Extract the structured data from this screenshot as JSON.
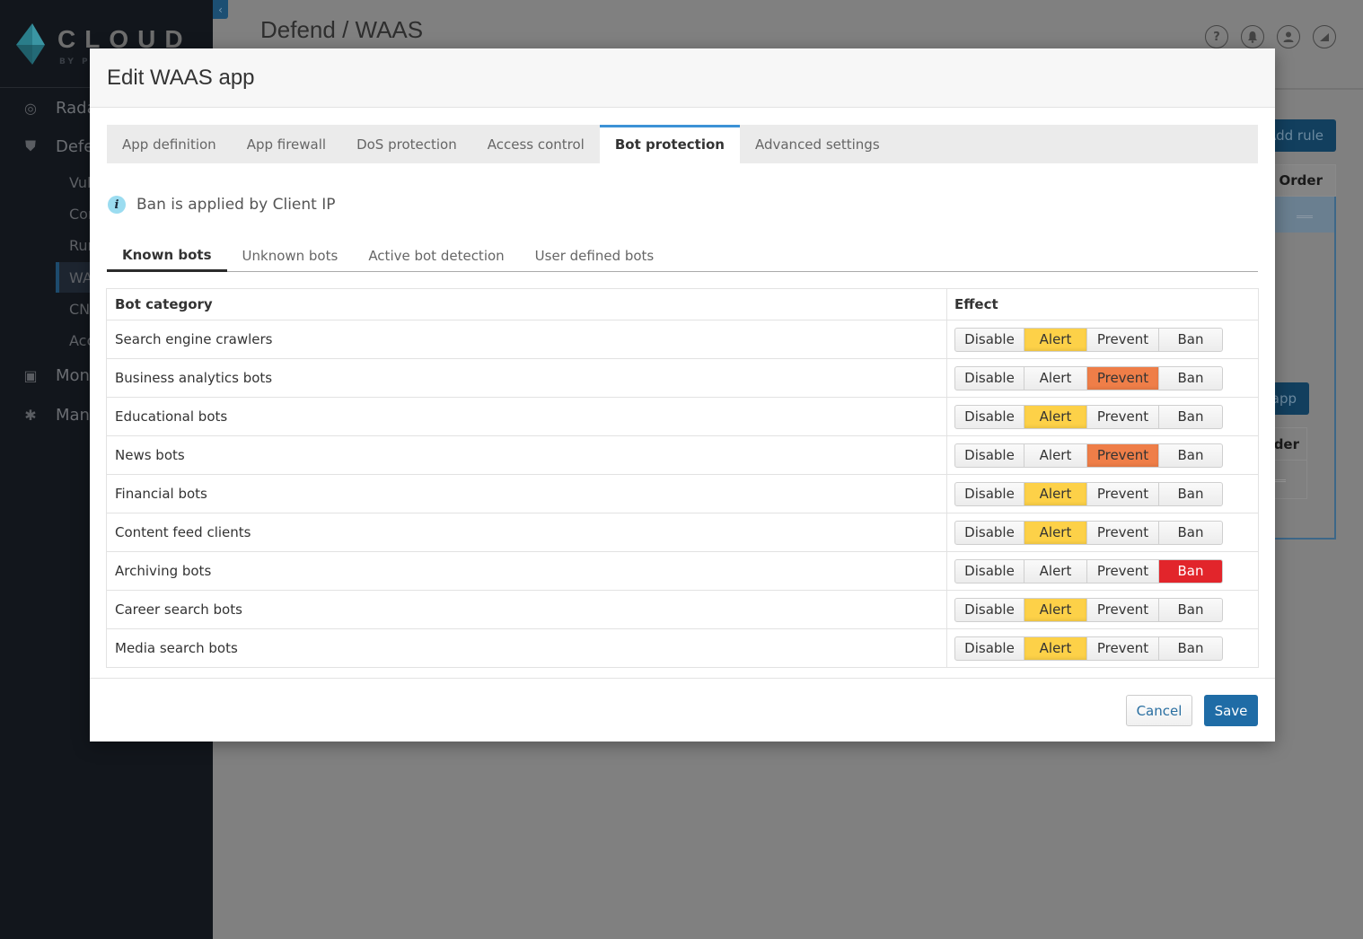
{
  "app": {
    "logo_text": "CLOUD",
    "logo_sub": "BY PALO ALTO NETWORKS",
    "collapse_icon": "chevron-left-icon"
  },
  "sidebar": {
    "items": [
      {
        "label": "Radar",
        "icon": "radar-icon"
      },
      {
        "label": "Defend",
        "icon": "shield-icon"
      },
      {
        "label": "Monitor",
        "icon": "monitor-icon"
      },
      {
        "label": "Manage",
        "icon": "gear-icon"
      }
    ],
    "sub_items": [
      {
        "label": "Vulnerabilities",
        "active": false
      },
      {
        "label": "Compliance",
        "active": false
      },
      {
        "label": "Runtime",
        "active": false
      },
      {
        "label": "WAAS",
        "active": true
      },
      {
        "label": "CNNF",
        "active": false
      },
      {
        "label": "Access",
        "active": false
      }
    ]
  },
  "header": {
    "breadcrumb": "Defend / WAAS",
    "icons": [
      "help-icon",
      "bell-icon",
      "user-icon",
      "chart-icon"
    ],
    "help_glyph": "?"
  },
  "background": {
    "add_rule_label": "Add rule",
    "order_header": "Order",
    "add_app_label": "app",
    "order_header_2": "der"
  },
  "modal": {
    "title": "Edit WAAS app",
    "tabs": [
      {
        "label": "App definition",
        "active": false
      },
      {
        "label": "App firewall",
        "active": false
      },
      {
        "label": "DoS protection",
        "active": false
      },
      {
        "label": "Access control",
        "active": false
      },
      {
        "label": "Bot protection",
        "active": true
      },
      {
        "label": "Advanced settings",
        "active": false
      }
    ],
    "info": {
      "icon_glyph": "i",
      "text": "Ban is applied by Client IP"
    },
    "subtabs": [
      {
        "label": "Known bots",
        "active": true
      },
      {
        "label": "Unknown bots",
        "active": false
      },
      {
        "label": "Active bot detection",
        "active": false
      },
      {
        "label": "User defined bots",
        "active": false
      }
    ],
    "table": {
      "headers": {
        "category": "Bot category",
        "effect": "Effect"
      },
      "effect_options": [
        "Disable",
        "Alert",
        "Prevent",
        "Ban"
      ],
      "rows": [
        {
          "category": "Search engine crawlers",
          "effect": "Alert"
        },
        {
          "category": "Business analytics bots",
          "effect": "Prevent"
        },
        {
          "category": "Educational bots",
          "effect": "Alert"
        },
        {
          "category": "News bots",
          "effect": "Prevent"
        },
        {
          "category": "Financial bots",
          "effect": "Alert"
        },
        {
          "category": "Content feed clients",
          "effect": "Alert"
        },
        {
          "category": "Archiving bots",
          "effect": "Ban"
        },
        {
          "category": "Career search bots",
          "effect": "Alert"
        },
        {
          "category": "Media search bots",
          "effect": "Alert"
        }
      ]
    },
    "footer": {
      "cancel_label": "Cancel",
      "save_label": "Save"
    }
  },
  "colors": {
    "alert": "#fdd148",
    "prevent": "#ef7e48",
    "ban": "#e2252b",
    "primary": "#1f6ca6",
    "active_tab_accent": "#3c92d6"
  }
}
